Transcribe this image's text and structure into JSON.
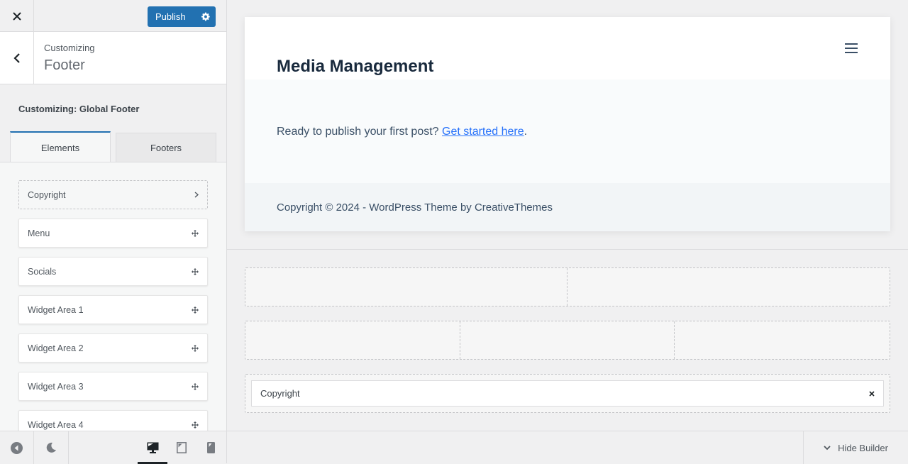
{
  "topbar": {
    "close_icon": "close-icon",
    "publish_label": "Publish",
    "publish_settings_icon": "gear-icon",
    "accent": "#2271b1"
  },
  "section": {
    "back_icon": "chevron-left-icon",
    "crumb": "Customizing",
    "title": "Footer"
  },
  "panel": {
    "title": "Customizing: Global Footer",
    "tabs": [
      {
        "label": "Elements",
        "active": true
      },
      {
        "label": "Footers",
        "active": false
      }
    ],
    "elements": [
      {
        "label": "Copyright",
        "state": "in-use",
        "icon": "chevron-right-icon"
      },
      {
        "label": "Menu",
        "state": "available",
        "icon": "move-icon"
      },
      {
        "label": "Socials",
        "state": "available",
        "icon": "move-icon"
      },
      {
        "label": "Widget Area 1",
        "state": "available",
        "icon": "move-icon"
      },
      {
        "label": "Widget Area 2",
        "state": "available",
        "icon": "move-icon"
      },
      {
        "label": "Widget Area 3",
        "state": "available",
        "icon": "move-icon"
      },
      {
        "label": "Widget Area 4",
        "state": "available",
        "icon": "move-icon"
      }
    ]
  },
  "bottombar": {
    "collapse_icon": "collapse-sidebar-icon",
    "dark_mode_icon": "moon-icon",
    "devices": [
      {
        "name": "desktop",
        "icon": "desktop-icon",
        "active": true
      },
      {
        "name": "tablet",
        "icon": "tablet-icon",
        "active": false
      },
      {
        "name": "mobile",
        "icon": "mobile-icon",
        "active": false
      }
    ]
  },
  "preview": {
    "site_title": "Media Management",
    "menu_icon": "hamburger-icon",
    "content_text": "Ready to publish your first post?",
    "content_link": "Get started here",
    "content_after": ".",
    "footer_text": "Copyright © 2024 - WordPress Theme by CreativeThemes"
  },
  "builder": {
    "rows": [
      {
        "columns": 2,
        "items": []
      },
      {
        "columns": 3,
        "items": []
      },
      {
        "columns": 1,
        "items": [
          "Copyright"
        ]
      }
    ],
    "remove_icon": "close-icon",
    "hide_label": "Hide Builder",
    "hide_icon": "chevron-down-icon"
  }
}
